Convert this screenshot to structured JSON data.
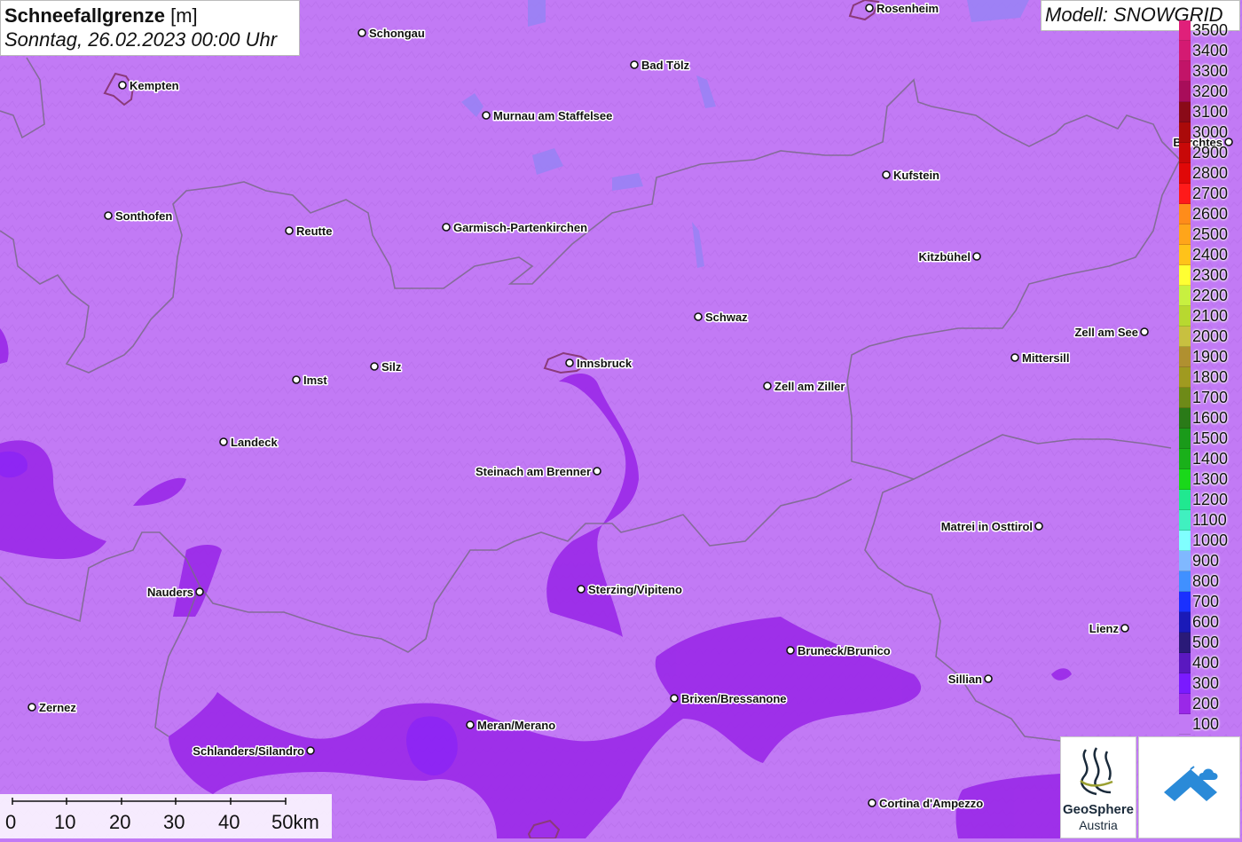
{
  "title": {
    "main": "Schneefallgrenze",
    "unit": "[m]",
    "datetime": "Sonntag, 26.02.2023 00:00 Uhr"
  },
  "model": "Modell: SNOWGRID",
  "legend": [
    {
      "label": "3500",
      "color": "#e0207a"
    },
    {
      "label": "3400",
      "color": "#d41a72"
    },
    {
      "label": "3300",
      "color": "#c21468"
    },
    {
      "label": "3200",
      "color": "#a80d5a"
    },
    {
      "label": "3100",
      "color": "#8a0a18"
    },
    {
      "label": "3000",
      "color": "#aa0a0a"
    },
    {
      "label": "2900",
      "color": "#c80808"
    },
    {
      "label": "2800",
      "color": "#e00808"
    },
    {
      "label": "2700",
      "color": "#ff1a1a"
    },
    {
      "label": "2600",
      "color": "#ff8c1a"
    },
    {
      "label": "2500",
      "color": "#ffa51a"
    },
    {
      "label": "2400",
      "color": "#ffc21a"
    },
    {
      "label": "2300",
      "color": "#ffff33"
    },
    {
      "label": "2200",
      "color": "#c8f040"
    },
    {
      "label": "2100",
      "color": "#b8d830"
    },
    {
      "label": "2000",
      "color": "#c8c040"
    },
    {
      "label": "1900",
      "color": "#b09030"
    },
    {
      "label": "1800",
      "color": "#a09a20"
    },
    {
      "label": "1700",
      "color": "#6e8a18"
    },
    {
      "label": "1600",
      "color": "#2a7a18"
    },
    {
      "label": "1500",
      "color": "#1a9a1a"
    },
    {
      "label": "1400",
      "color": "#1ab01a"
    },
    {
      "label": "1300",
      "color": "#1ad81a"
    },
    {
      "label": "1200",
      "color": "#20e890"
    },
    {
      "label": "1100",
      "color": "#40f0c0"
    },
    {
      "label": "1000",
      "color": "#80ffff"
    },
    {
      "label": "900",
      "color": "#80b8ff"
    },
    {
      "label": "800",
      "color": "#4090ff"
    },
    {
      "label": "700",
      "color": "#1a30ff"
    },
    {
      "label": "600",
      "color": "#1a1ab8"
    },
    {
      "label": "500",
      "color": "#2a1a78"
    },
    {
      "label": "400",
      "color": "#5a18c0"
    },
    {
      "label": "300",
      "color": "#7a1aff"
    },
    {
      "label": "200",
      "color": "#9a28e8"
    },
    {
      "label": "100",
      "color": "#c27af5"
    }
  ],
  "cities": [
    {
      "name": "Schongau"
    },
    {
      "name": "Rosenheim"
    },
    {
      "name": "Bad Tölz"
    },
    {
      "name": "Kempten"
    },
    {
      "name": "Murnau am Staffelsee"
    },
    {
      "name": "Berchtes"
    },
    {
      "name": "Kufstein"
    },
    {
      "name": "Sonthofen"
    },
    {
      "name": "Reutte"
    },
    {
      "name": "Garmisch-Partenkirchen"
    },
    {
      "name": "Kitzbühel"
    },
    {
      "name": "Schwaz"
    },
    {
      "name": "Zell am See"
    },
    {
      "name": "Mittersill"
    },
    {
      "name": "Silz"
    },
    {
      "name": "Innsbruck"
    },
    {
      "name": "Imst"
    },
    {
      "name": "Zell am Ziller"
    },
    {
      "name": "Landeck"
    },
    {
      "name": "Steinach am Brenner"
    },
    {
      "name": "Matrei in Osttirol"
    },
    {
      "name": "Nauders"
    },
    {
      "name": "Sterzing/Vipiteno"
    },
    {
      "name": "Lienz"
    },
    {
      "name": "Bruneck/Brunico"
    },
    {
      "name": "Sillian"
    },
    {
      "name": "Brixen/Bressanone"
    },
    {
      "name": "Zernez"
    },
    {
      "name": "Meran/Merano"
    },
    {
      "name": "Schlanders/Silandro"
    },
    {
      "name": "Cortina d'Ampezzo"
    }
  ],
  "scale": {
    "labels": [
      "0",
      "10",
      "20",
      "30",
      "40",
      "50km"
    ]
  },
  "logos": {
    "geosphere_name": "GeoSphere",
    "geosphere_sub": "Austria"
  },
  "icons": {
    "geosphere": "geosphere-logo-icon",
    "snowgrid": "snowgrid-logo-icon"
  }
}
